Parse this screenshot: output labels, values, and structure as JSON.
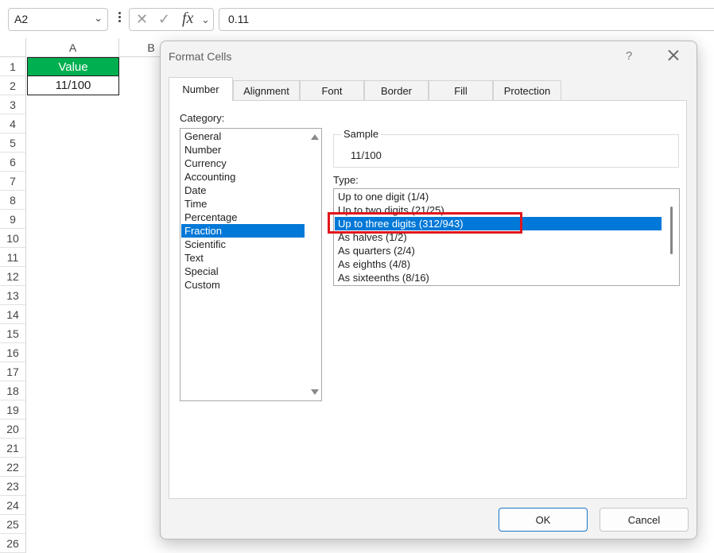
{
  "formula_bar": {
    "name_box": "A2",
    "formula": "0.11"
  },
  "sheet": {
    "columns": [
      "A",
      "B"
    ],
    "rows": [
      "1",
      "2",
      "3",
      "4",
      "5",
      "6",
      "7",
      "8",
      "9",
      "10",
      "11",
      "12",
      "13",
      "14",
      "15",
      "16",
      "17",
      "18",
      "19",
      "20",
      "21",
      "22",
      "23",
      "24",
      "25",
      "26"
    ],
    "cells": {
      "a1": "Value",
      "a2": "11/100"
    },
    "header_color": "#00b050"
  },
  "dialog": {
    "title": "Format Cells",
    "help": "?",
    "tabs": [
      "Number",
      "Alignment",
      "Font",
      "Border",
      "Fill",
      "Protection"
    ],
    "active_tab": "Number",
    "category_label": "Category:",
    "categories": [
      "General",
      "Number",
      "Currency",
      "Accounting",
      "Date",
      "Time",
      "Percentage",
      "Fraction",
      "Scientific",
      "Text",
      "Special",
      "Custom"
    ],
    "selected_category": "Fraction",
    "sample_label": "Sample",
    "sample_value": "11/100",
    "type_label": "Type:",
    "types": [
      "Up to one digit (1/4)",
      "Up to two digits (21/25)",
      "Up to three digits (312/943)",
      "As halves (1/2)",
      "As quarters (2/4)",
      "As eighths (4/8)",
      "As sixteenths (8/16)"
    ],
    "selected_type": "Up to three digits (312/943)",
    "ok_label": "OK",
    "cancel_label": "Cancel",
    "accent_color": "#0078d7",
    "highlight_color": "#e0161d"
  }
}
